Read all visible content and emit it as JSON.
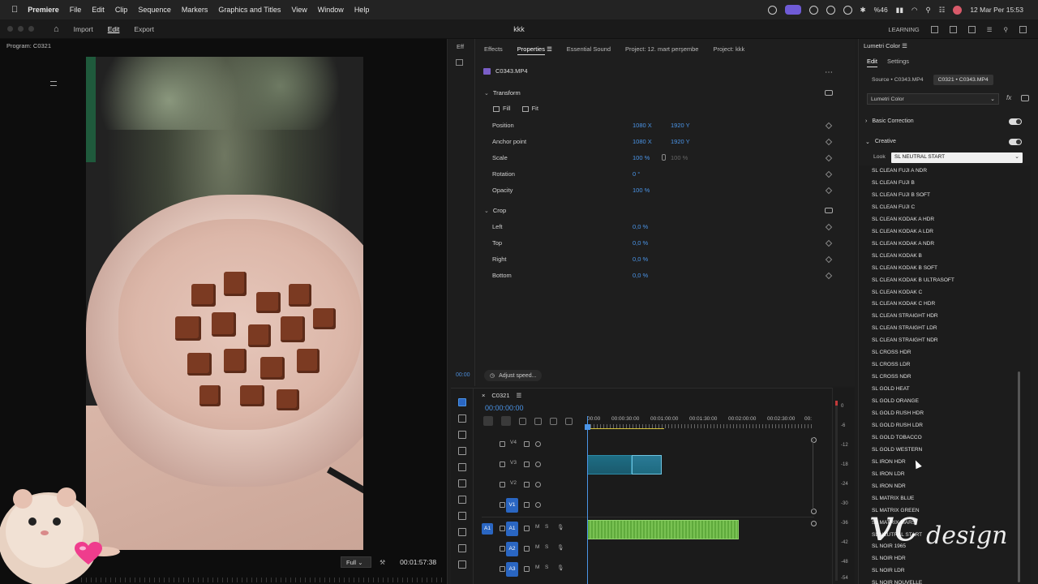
{
  "menubar": {
    "app": "Premiere",
    "items": [
      "File",
      "Edit",
      "Clip",
      "Sequence",
      "Markers",
      "Graphics and Titles",
      "View",
      "Window",
      "Help"
    ],
    "battery": "%46",
    "datetime": "12 Mar Per 15:53"
  },
  "header": {
    "nav": [
      "Import",
      "Edit",
      "Export"
    ],
    "active_nav": "Edit",
    "project_title": "kkk",
    "workspace": "LEARNING"
  },
  "program": {
    "label": "Program: C0321",
    "zoom": "Full",
    "timecode": "00:01:57:38"
  },
  "mini_strip": {
    "label": "Eff",
    "timecode": "00:00"
  },
  "properties": {
    "tabs": [
      "Effects",
      "Properties",
      "Essential Sound",
      "Project: 12. mart perşembe",
      "Project: kkk"
    ],
    "active_tab": "Properties",
    "clip_name": "C0343.MP4",
    "transform_label": "Transform",
    "fill_label": "Fill",
    "fit_label": "Fit",
    "rows": [
      {
        "label": "Position",
        "v1": "1080 X",
        "v2": "1920 Y"
      },
      {
        "label": "Anchor point",
        "v1": "1080 X",
        "v2": "1920 Y"
      },
      {
        "label": "Scale",
        "v1": "100 %",
        "v2": "100 %"
      },
      {
        "label": "Rotation",
        "v1": "0 °",
        "v2": ""
      },
      {
        "label": "Opacity",
        "v1": "100 %",
        "v2": ""
      }
    ],
    "crop_label": "Crop",
    "crop_rows": [
      {
        "label": "Left",
        "v1": "0,0 %"
      },
      {
        "label": "Top",
        "v1": "0,0 %"
      },
      {
        "label": "Right",
        "v1": "0,0 %"
      },
      {
        "label": "Bottom",
        "v1": "0,0 %"
      }
    ],
    "adjust_speed": "Adjust speed..."
  },
  "timeline": {
    "sequence": "C0321",
    "timecode": "00:00:00:00",
    "ruler": [
      "00:00",
      "00:00:30:00",
      "00:01:00:00",
      "00:01:30:00",
      "00:02:00:00",
      "00:02:30:00",
      "00:"
    ],
    "video_tracks": [
      "V4",
      "V3",
      "V2",
      "V1"
    ],
    "audio_tracks": [
      "A1",
      "A2",
      "A3"
    ],
    "source_v": "V1",
    "source_a": "A1",
    "mute": "M",
    "solo": "S"
  },
  "meter": {
    "labels": [
      "0",
      "-6",
      "-12",
      "-18",
      "-24",
      "-30",
      "-36",
      "-42",
      "-48",
      "-54"
    ]
  },
  "lumetri": {
    "title": "Lumetri Color",
    "tabs": [
      "Edit",
      "Settings"
    ],
    "source_chip": "Source • C0343.MP4",
    "seq_chip": "C0321 • C0343.MP4",
    "effect": "Lumetri Color",
    "basic_correction": "Basic Correction",
    "creative": "Creative",
    "look_label": "Look",
    "look_value": "SL NEUTRAL START",
    "looks": [
      "SL CLEAN FUJI A NDR",
      "SL CLEAN FUJI B",
      "SL CLEAN FUJI B SOFT",
      "SL CLEAN FUJI C",
      "SL CLEAN KODAK A HDR",
      "SL CLEAN KODAK A LDR",
      "SL CLEAN KODAK A NDR",
      "SL CLEAN KODAK B",
      "SL CLEAN KODAK B SOFT",
      "SL CLEAN KODAK B ULTRASOFT",
      "SL CLEAN KODAK C",
      "SL CLEAN KODAK C HDR",
      "SL CLEAN STRAIGHT HDR",
      "SL CLEAN STRAIGHT LDR",
      "SL CLEAN STRAIGHT NDR",
      "SL CROSS HDR",
      "SL CROSS LDR",
      "SL CROSS NDR",
      "SL GOLD HEAT",
      "SL GOLD ORANGE",
      "SL GOLD RUSH HDR",
      "SL GOLD RUSH LDR",
      "SL GOLD TOBACCO",
      "SL GOLD WESTERN",
      "SL IRON HDR",
      "SL IRON LDR",
      "SL IRON NDR",
      "SL MATRIX BLUE",
      "SL MATRIX GREEN",
      "SL MATRIX MARS",
      "SL NEUTRAL START",
      "SL NOIR 1965",
      "SL NOIR HDR",
      "SL NOIR LDR",
      "SL NOIR NOUVELLE"
    ]
  },
  "watermark": {
    "left": "vc",
    "right": "design"
  },
  "colors": {
    "accent": "#4b95e8",
    "audio_clip": "#79c253",
    "video_clip": "#1e6d84"
  }
}
